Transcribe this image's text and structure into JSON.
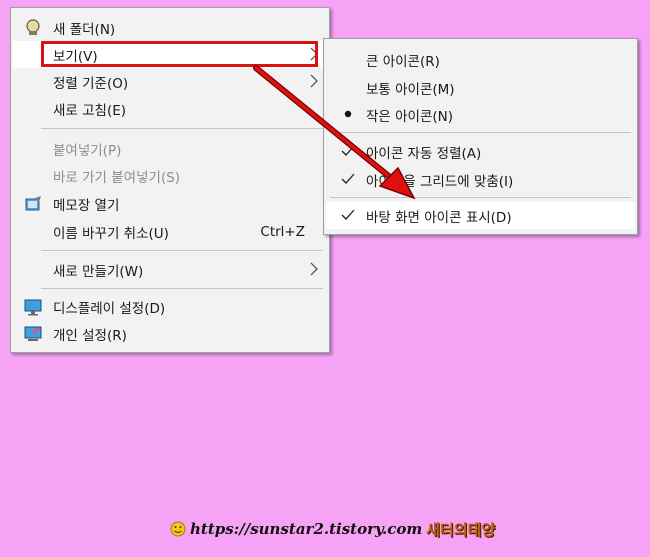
{
  "main_menu": {
    "items": [
      {
        "label": "새 폴더(N)",
        "icon": "new-folder-icon"
      },
      {
        "label": "보기(V)",
        "submenu": true
      },
      {
        "label": "정렬 기준(O)",
        "submenu": true
      },
      {
        "label": "새로 고침(E)"
      },
      {
        "label": "붙여넣기(P)",
        "disabled": true
      },
      {
        "label": "바로 가기 붙여넣기(S)",
        "disabled": true
      },
      {
        "label": "메모장 열기",
        "icon": "notepad-icon"
      },
      {
        "label": "이름 바꾸기 취소(U)",
        "shortcut": "Ctrl+Z"
      },
      {
        "label": "새로 만들기(W)",
        "submenu": true
      },
      {
        "label": "디스플레이 설정(D)",
        "icon": "display-icon"
      },
      {
        "label": "개인 설정(R)",
        "icon": "personalize-icon"
      }
    ]
  },
  "view_submenu": {
    "items": [
      {
        "label": "큰 아이콘(R)"
      },
      {
        "label": "보통 아이콘(M)"
      },
      {
        "label": "작은 아이콘(N)",
        "mark": "bullet"
      },
      {
        "label": "아이콘 자동 정렬(A)",
        "mark": "check"
      },
      {
        "label": "아이콘을 그리드에 맞춤(I)",
        "mark": "check"
      },
      {
        "label": "바탕 화면 아이콘 표시(D)",
        "mark": "check"
      }
    ]
  },
  "watermark": {
    "url": "https://sunstar2.tistory.com",
    "name": "새터의태양"
  },
  "colors": {
    "background": "#f6a3f6",
    "menu_bg": "#f2f2f2",
    "highlight": "#dd1111"
  }
}
